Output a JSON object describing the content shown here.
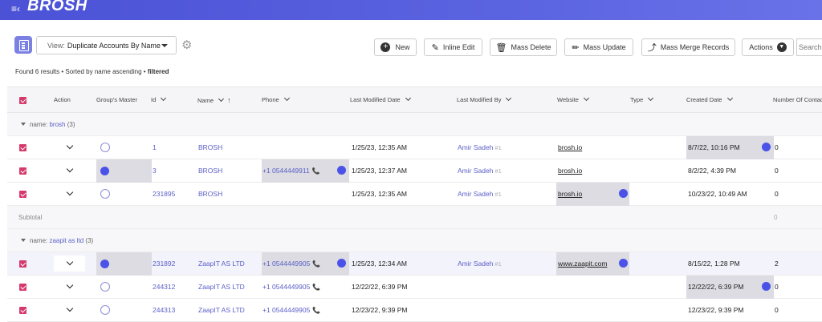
{
  "app": {
    "brand": "BROSH"
  },
  "toolbar": {
    "view_label": "View:",
    "view_value": "Duplicate Accounts By Name",
    "buttons": {
      "new": "New",
      "inline_edit": "Inline Edit",
      "mass_delete": "Mass Delete",
      "mass_update": "Mass Update",
      "mass_merge": "Mass Merge Records",
      "actions": "Actions"
    },
    "search_placeholder": "Search"
  },
  "status": {
    "prefix": "Found 6 results • Sorted by name ascending • ",
    "filtered": "filtered"
  },
  "columns": {
    "action": "Action",
    "groups_master": "Group's Master",
    "id": "Id",
    "name": "Name",
    "phone": "Phone",
    "last_modified_date": "Last Modified Date",
    "last_modified_by": "Last Modified By",
    "website": "Website",
    "type": "Type",
    "created_date": "Created Date",
    "number_of_contacts": "Number Of Contac"
  },
  "groups": [
    {
      "label": "name:",
      "value": "brosh",
      "count": "(3)",
      "rows": [
        {
          "id": "1",
          "name": "BROSH",
          "phone": "",
          "modified": "1/25/23, 12:35 AM",
          "modified_by": "Amir Sadeh",
          "modified_by_tag": "#1",
          "website": "brosh.io",
          "created": "8/7/22, 10:16 PM",
          "contacts": "0"
        },
        {
          "id": "3",
          "name": "BROSH",
          "phone": "+1 0544449911",
          "modified": "1/25/23, 12:37 AM",
          "modified_by": "Amir Sadeh",
          "modified_by_tag": "#1",
          "website": "brosh.io",
          "created": "8/2/22, 4:39 PM",
          "contacts": "0"
        },
        {
          "id": "231895",
          "name": "BROSH",
          "phone": "",
          "modified": "1/25/23, 12:35 AM",
          "modified_by": "Amir Sadeh",
          "modified_by_tag": "#1",
          "website": "brosh.io",
          "created": "10/23/22, 10:49 AM",
          "contacts": "0"
        }
      ],
      "subtotal_label": "Subtotal",
      "subtotal_value": "0"
    },
    {
      "label": "name:",
      "value": "zaapit as ltd",
      "count": "(3)",
      "rows": [
        {
          "id": "231892",
          "name": "ZaapIT AS LTD",
          "phone": "+1 0544449905",
          "modified": "1/25/23, 12:34 AM",
          "modified_by": "Amir Sadeh",
          "modified_by_tag": "#1",
          "website": "www.zaapit.com",
          "created": "8/15/22, 1:28 PM",
          "contacts": "2"
        },
        {
          "id": "244312",
          "name": "ZaapIT AS LTD",
          "phone": "+1 0544449905",
          "modified": "12/22/22, 6:39 PM",
          "modified_by": "",
          "modified_by_tag": "",
          "website": "",
          "created": "12/22/22, 6:39 PM",
          "contacts": "0"
        },
        {
          "id": "244313",
          "name": "ZaapIT AS LTD",
          "phone": "+1 0544449905",
          "modified": "12/23/22, 9:39 PM",
          "modified_by": "",
          "modified_by_tag": "",
          "website": "",
          "created": "12/23/22, 9:39 PM",
          "contacts": "0"
        }
      ]
    }
  ]
}
